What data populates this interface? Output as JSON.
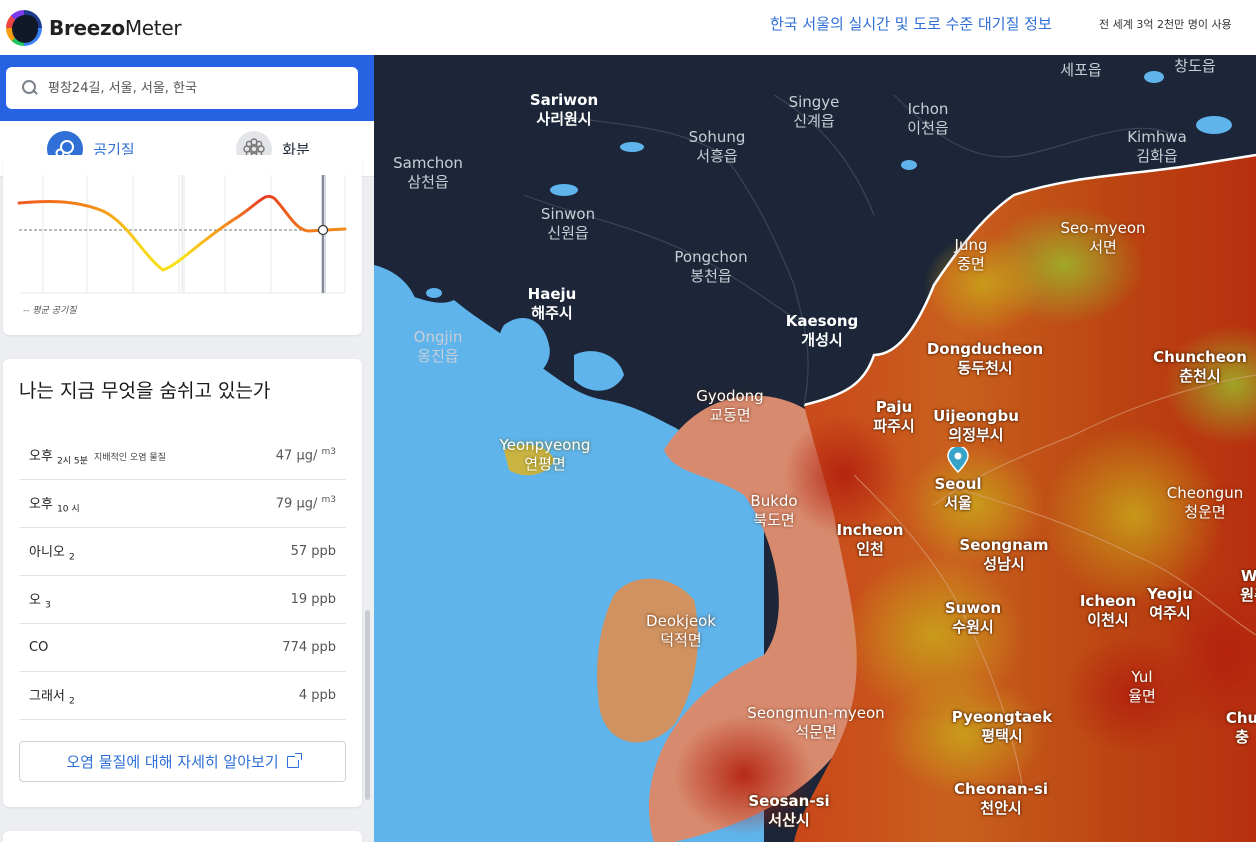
{
  "header": {
    "logo_bold": "Breezo",
    "logo_light": "Meter",
    "title_link": "한국 서울의 실시간 및 도로 수준 대기질 정보",
    "subtitle": "전 세계 3억 2천만 명이 사용"
  },
  "search": {
    "placeholder": "평창24길, 서울, 서울, 한국"
  },
  "tabs": [
    {
      "label": "공기질",
      "icon": "air-quality-icon",
      "active": true
    },
    {
      "label": "화분",
      "icon": "pollen-icon",
      "active": false
    }
  ],
  "chart": {
    "legend": "평균 공기질"
  },
  "pollutants": {
    "title": "나는 지금 무엇을 숨쉬고 있는가",
    "rows": [
      {
        "name": "오후",
        "sub": "2시 5분",
        "dominant": "지배적인 오염 물질",
        "value": "47 μg/",
        "unit_sup": "m3"
      },
      {
        "name": "오후",
        "sub": "10 시",
        "dominant": "",
        "value": "79 μg/",
        "unit_sup": "m3"
      },
      {
        "name": "아니오",
        "sub": "2",
        "dominant": "",
        "value": "57 ppb",
        "unit_sup": ""
      },
      {
        "name": "오",
        "sub": "3",
        "dominant": "",
        "value": "19 ppb",
        "unit_sup": ""
      },
      {
        "name": "CO",
        "sub": "",
        "dominant": "",
        "value": "774 ppb",
        "unit_sup": ""
      },
      {
        "name": "그래서",
        "sub": "2",
        "dominant": "",
        "value": "4 ppb",
        "unit_sup": ""
      }
    ],
    "learn_more": "오염 물질에 대해 자세히 알아보기"
  },
  "map": {
    "labels": {
      "sariwon": {
        "en": "Sariwon",
        "ko": "사리원시"
      },
      "singye": {
        "en": "Singye",
        "ko": "신계읍"
      },
      "ichon": {
        "en": "Ichon",
        "ko": "이천읍"
      },
      "sepo": {
        "en": "",
        "ko": "세포읍"
      },
      "changdo": {
        "en": "",
        "ko": "창도읍"
      },
      "sohung": {
        "en": "Sohung",
        "ko": "서흥읍"
      },
      "kimhwa": {
        "en": "Kimhwa",
        "ko": "김화읍"
      },
      "samchon": {
        "en": "Samchon",
        "ko": "삼천읍"
      },
      "sinwon": {
        "en": "Sinwon",
        "ko": "신원읍"
      },
      "seomyeon": {
        "en": "Seo-myeon",
        "ko": "서면"
      },
      "jung": {
        "en": "Jung",
        "ko": "중면"
      },
      "pongchon": {
        "en": "Pongchon",
        "ko": "봉천읍"
      },
      "haeju": {
        "en": "Haeju",
        "ko": "해주시"
      },
      "kaesong": {
        "en": "Kaesong",
        "ko": "개성시"
      },
      "ongjin": {
        "en": "Ongjin",
        "ko": "옹진읍"
      },
      "dongducheon": {
        "en": "Dongducheon",
        "ko": "동두천시"
      },
      "chuncheon": {
        "en": "Chuncheon",
        "ko": "춘천시"
      },
      "gyodong": {
        "en": "Gyodong",
        "ko": "교동면"
      },
      "paju": {
        "en": "Paju",
        "ko": "파주시"
      },
      "uijeongbu": {
        "en": "Uijeongbu",
        "ko": "의정부시"
      },
      "yeonpyeong": {
        "en": "Yeonpyeong",
        "ko": "연평면"
      },
      "seoul": {
        "en": "Seoul",
        "ko": "서울"
      },
      "cheongun": {
        "en": "Cheongun",
        "ko": "청운면"
      },
      "bukdo": {
        "en": "Bukdo",
        "ko": "북도면"
      },
      "incheon": {
        "en": "Incheon",
        "ko": "인천"
      },
      "seongnam": {
        "en": "Seongnam",
        "ko": "성남시"
      },
      "wo": {
        "en": "Wo",
        "ko": "원주"
      },
      "deokjeok": {
        "en": "Deokjeok",
        "ko": "덕적면"
      },
      "suwon": {
        "en": "Suwon",
        "ko": "수원시"
      },
      "icheon": {
        "en": "Icheon",
        "ko": "이천시"
      },
      "yeoju": {
        "en": "Yeoju",
        "ko": "여주시"
      },
      "yul": {
        "en": "Yul",
        "ko": "율면"
      },
      "seongmun": {
        "en": "Seongmun-myeon",
        "ko": "석문면"
      },
      "pyeongtaek": {
        "en": "Pyeongtaek",
        "ko": "평택시"
      },
      "chu": {
        "en": "Chu",
        "ko": "충"
      },
      "seosan": {
        "en": "Seosan-si",
        "ko": "서산시"
      },
      "cheonan": {
        "en": "Cheonan-si",
        "ko": "천안시"
      }
    }
  },
  "colors": {
    "accent": "#2f6fd6",
    "header_bar": "#2563e3",
    "sea": "#5fb0ea",
    "north_land": "#1c2638",
    "pollution_dark": "#b8380f",
    "pollution_mid": "#d0741c",
    "pin": "#36a3c9"
  }
}
